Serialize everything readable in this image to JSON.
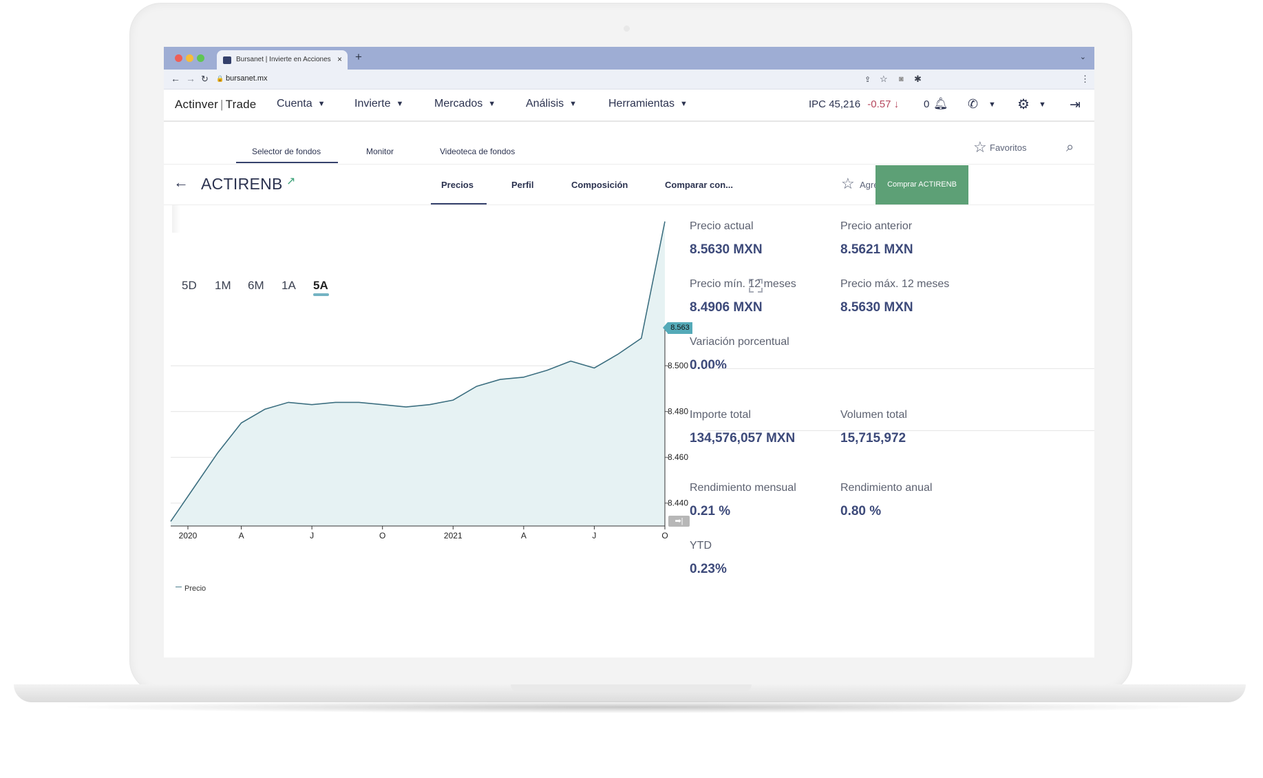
{
  "browser": {
    "tab_title": "Bursanet | Invierte en Acciones",
    "tab_close": "×",
    "new_tab": "+",
    "url": "bursanet.mx"
  },
  "header": {
    "logo_main": "Actinver",
    "logo_sep": "|",
    "logo_sub": "Trade",
    "menu": [
      "Cuenta",
      "Invierte",
      "Mercados",
      "Análisis",
      "Herramientas"
    ],
    "ipc_label": "IPC",
    "ipc_value": "45,216",
    "ipc_change": "-0.57",
    "notifications": "0"
  },
  "subnav": {
    "items": [
      "Selector de fondos",
      "Monitor",
      "Videoteca de fondos"
    ],
    "favorites": "Favoritos"
  },
  "fund": {
    "name": "ACTIRENB",
    "tabs": [
      "Precios",
      "Perfil",
      "Composición",
      "Comparar con..."
    ],
    "added": "Agregado",
    "buy": "Comprar  ACTIRENB"
  },
  "ranges": [
    "5D",
    "1M",
    "6M",
    "1A",
    "5A"
  ],
  "chart_data": {
    "type": "area",
    "series": [
      {
        "name": "Precio",
        "x": [
          "2020-01",
          "2020-02",
          "2020-03",
          "2020-04",
          "2020-05",
          "2020-06",
          "2020-07",
          "2020-08",
          "2020-09",
          "2020-10",
          "2020-11",
          "2020-12",
          "2021-01",
          "2021-02",
          "2021-03",
          "2021-04",
          "2021-05",
          "2021-06",
          "2021-07",
          "2021-08",
          "2021-09",
          "2021-10"
        ],
        "values": [
          8.432,
          8.447,
          8.462,
          8.475,
          8.481,
          8.484,
          8.483,
          8.484,
          8.484,
          8.483,
          8.482,
          8.483,
          8.485,
          8.491,
          8.494,
          8.495,
          8.498,
          8.502,
          8.499,
          8.505,
          8.512,
          8.563
        ]
      }
    ],
    "x_tick_labels": [
      "2020",
      "A",
      "J",
      "O",
      "2021",
      "A",
      "J",
      "O"
    ],
    "y_ticks": [
      8.44,
      8.46,
      8.48,
      8.5
    ],
    "y_tick_labels": [
      "8.440",
      "8.460",
      "8.480",
      "8.500"
    ],
    "last_value_label": "8.563",
    "ylim": [
      8.43,
      8.519
    ],
    "legend": "Precio",
    "legend_position": "bottom-left",
    "grid": true,
    "colors": {
      "line": "#3c6f80",
      "fill": "#e6f2f3",
      "tag": "#54aab8"
    }
  },
  "stats": [
    {
      "label": "Precio actual",
      "value": "8.5630 MXN"
    },
    {
      "label": "Precio anterior",
      "value": "8.5621 MXN"
    },
    {
      "label": "Precio mín. 12 meses",
      "value": "8.4906 MXN"
    },
    {
      "label": "Precio máx. 12 meses",
      "value": "8.5630 MXN"
    },
    {
      "label": "Variación porcentual",
      "value": "0.00%"
    },
    {
      "label": "Importe total",
      "value": "134,576,057 MXN"
    },
    {
      "label": "Volumen total",
      "value": "15,715,972"
    },
    {
      "label": "Rendimiento mensual",
      "value": "0.21 %"
    },
    {
      "label": "Rendimiento anual",
      "value": "0.80 %"
    },
    {
      "label": "YTD",
      "value": "0.23%"
    }
  ]
}
